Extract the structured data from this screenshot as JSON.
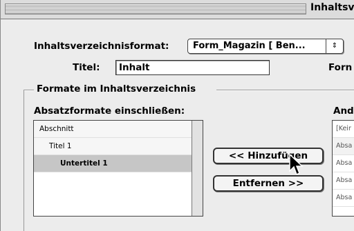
{
  "window": {
    "title": "Inhaltsv"
  },
  "format_row": {
    "label": "Inhaltsverzeichnisformat:",
    "value": "Form_Magazin [ Ben...",
    "arrow": "⇕"
  },
  "title_row": {
    "label": "Titel:",
    "value": "Inhalt",
    "right_label": "Forn"
  },
  "group": {
    "label": "Formate im Inhaltsverzeichnis"
  },
  "left_list": {
    "header": "Absatzformate einschließen:",
    "items": [
      "Abschnitt",
      "Titel 1",
      "Untertitel 1"
    ]
  },
  "right_list": {
    "header": "And",
    "items": [
      "[Keir",
      "Absa",
      "Absa",
      "Absa",
      "Absa"
    ]
  },
  "buttons": {
    "add": "<< Hinzufügen",
    "remove": "Entfernen >>"
  }
}
